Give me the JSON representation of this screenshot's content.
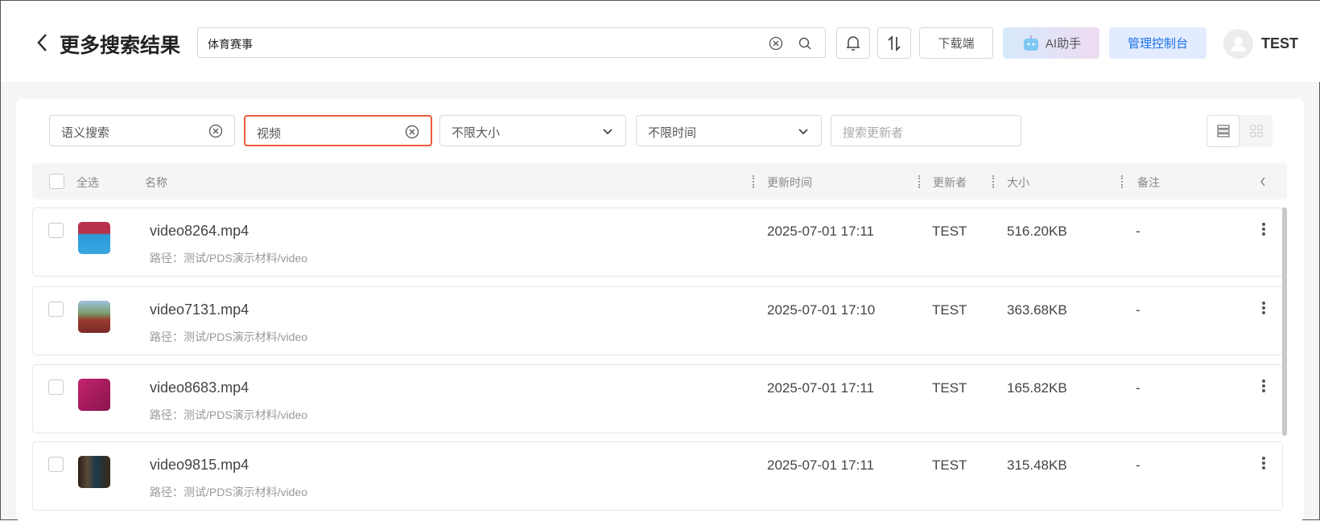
{
  "header": {
    "title": "更多搜索结果",
    "search_value": "体育赛事",
    "download_label": "下载端",
    "ai_label": "AI助手",
    "console_label": "管理控制台",
    "user": "TEST"
  },
  "filters": {
    "semantic": "语义搜索",
    "type": "视频",
    "size": "不限大小",
    "time": "不限时间",
    "updater_placeholder": "搜索更新者"
  },
  "table": {
    "select_all": "全选",
    "columns": [
      "名称",
      "更新时间",
      "更新者",
      "大小",
      "备注"
    ]
  },
  "rows": [
    {
      "name": "video8264.mp4",
      "path": "路径：测试/PDS演示材料/video",
      "time": "2025-07-01 17:11",
      "updater": "TEST",
      "size": "516.20KB",
      "note": "-"
    },
    {
      "name": "video7131.mp4",
      "path": "路径：测试/PDS演示材料/video",
      "time": "2025-07-01 17:10",
      "updater": "TEST",
      "size": "363.68KB",
      "note": "-"
    },
    {
      "name": "video8683.mp4",
      "path": "路径：测试/PDS演示材料/video",
      "time": "2025-07-01 17:11",
      "updater": "TEST",
      "size": "165.82KB",
      "note": "-"
    },
    {
      "name": "video9815.mp4",
      "path": "路径：测试/PDS演示材料/video",
      "time": "2025-07-01 17:11",
      "updater": "TEST",
      "size": "315.48KB",
      "note": "-"
    }
  ],
  "colors": {
    "active_filter": "#ee5a3a",
    "console_text": "#1a73e8",
    "console_bg": "#e3ebff"
  }
}
